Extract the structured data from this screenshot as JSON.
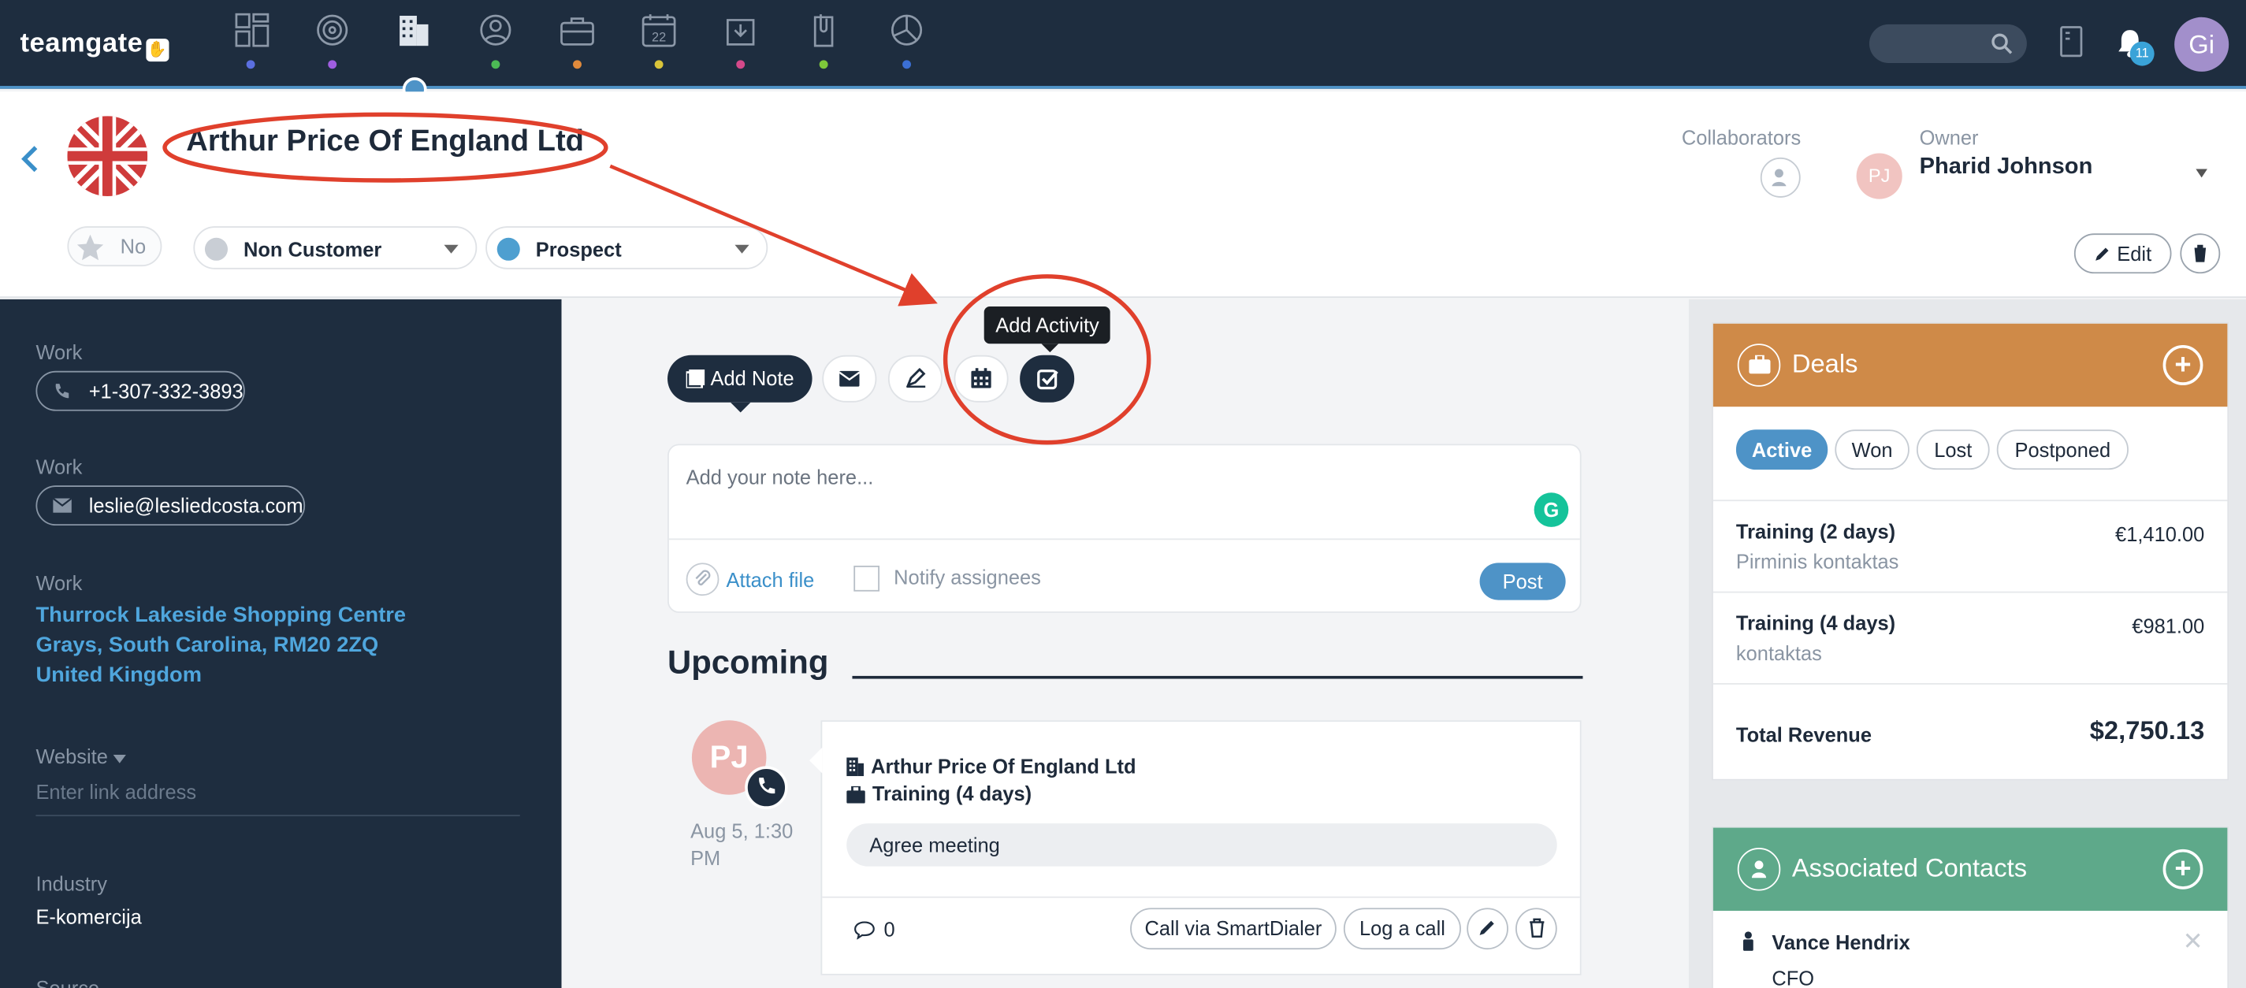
{
  "app": {
    "logo": "teamgate"
  },
  "topbar": {
    "notification_count": "11",
    "user_initials": "Gi"
  },
  "company": {
    "name": "Arthur Price Of England Ltd",
    "starred_label": "No",
    "customer_status": "Non Customer",
    "stage": "Prospect",
    "collaborators_label": "Collaborators",
    "owner_label": "Owner",
    "owner_initials": "PJ",
    "owner_name": "Pharid Johnson",
    "edit_label": "Edit"
  },
  "sidebar": {
    "phone_label": "Work",
    "phone": "+1-307-332-3893",
    "email_label": "Work",
    "email": "leslie@lesliedcosta.com",
    "address_label": "Work",
    "address_lines": [
      "Thurrock Lakeside Shopping Centre",
      "Grays, South Carolina, RM20 2ZQ",
      "United Kingdom"
    ],
    "website_label": "Website",
    "website_placeholder": "Enter link address",
    "industry_label": "Industry",
    "industry": "E-komercija",
    "source_label": "Source"
  },
  "composer": {
    "tooltip": "Add Activity",
    "add_note_label": "Add Note",
    "note_placeholder": "Add your note here...",
    "attach_label": "Attach file",
    "notify_label": "Notify assignees",
    "post_label": "Post"
  },
  "upcoming": {
    "heading": "Upcoming",
    "activity": {
      "avatar_initials": "PJ",
      "time": "Aug 5, 1:30 PM",
      "company": "Arthur Price Of England Ltd",
      "deal": "Training (4 days)",
      "title": "Agree meeting",
      "comment_count": "0",
      "smartdialer_label": "Call via SmartDialer",
      "log_call_label": "Log a call"
    }
  },
  "deals": {
    "title": "Deals",
    "tabs": [
      "Active",
      "Won",
      "Lost",
      "Postponed"
    ],
    "items": [
      {
        "name": "Training (2 days)",
        "contact": "Pirminis kontaktas",
        "amount": "€1,410.00"
      },
      {
        "name": "Training (4 days)",
        "contact": "kontaktas",
        "amount": "€981.00"
      }
    ],
    "total_label": "Total Revenue",
    "total_value": "$2,750.13"
  },
  "contacts": {
    "title": "Associated Contacts",
    "items": [
      {
        "name": "Vance Hendrix",
        "role": "CFO"
      }
    ]
  },
  "colors": {
    "navy": "#1e2d3f",
    "accent": "#4e93c7",
    "deals_header": "#cf8a48",
    "contacts_header": "#5ea98a",
    "annotation": "#e0402c"
  }
}
